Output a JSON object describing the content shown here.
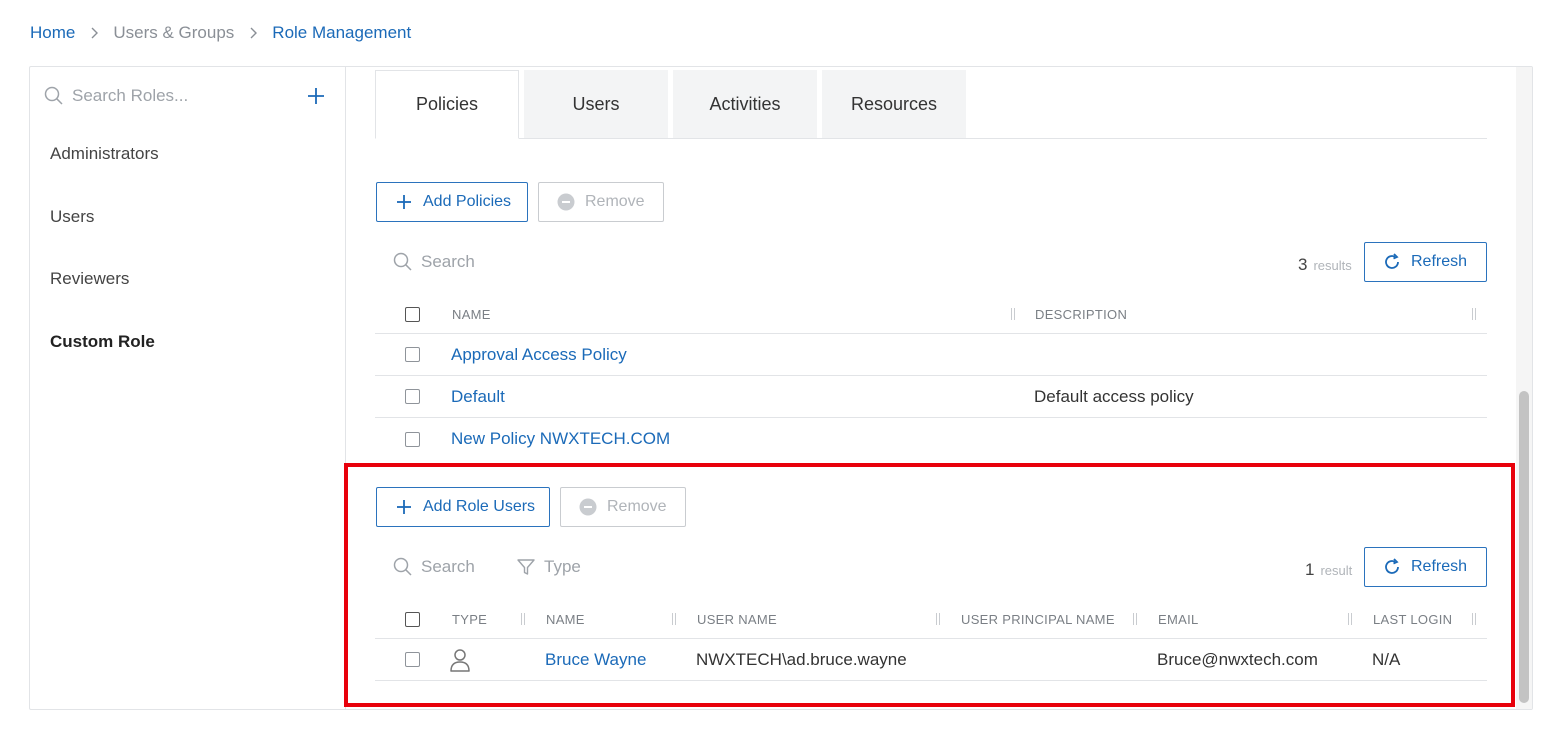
{
  "breadcrumb": {
    "home": "Home",
    "users_groups": "Users & Groups",
    "current": "Role Management"
  },
  "sidebar": {
    "search_placeholder": "Search Roles...",
    "add_icon": "plus-icon",
    "items": [
      {
        "label": "Administrators",
        "active": false
      },
      {
        "label": "Users",
        "active": false
      },
      {
        "label": "Reviewers",
        "active": false
      },
      {
        "label": "Custom Role",
        "active": true
      }
    ]
  },
  "tabs": [
    {
      "label": "Policies",
      "active": true
    },
    {
      "label": "Users",
      "active": false
    },
    {
      "label": "Activities",
      "active": false
    },
    {
      "label": "Resources",
      "active": false
    }
  ],
  "policies": {
    "add_label": "Add Policies",
    "remove_label": "Remove",
    "search_placeholder": "Search",
    "count": "3",
    "count_label": "results",
    "refresh_label": "Refresh",
    "columns": {
      "name": "NAME",
      "description": "DESCRIPTION"
    },
    "rows": [
      {
        "name": "Approval Access Policy",
        "description": ""
      },
      {
        "name": "Default",
        "description": "Default access policy"
      },
      {
        "name": "New Policy NWXTECH.COM",
        "description": ""
      }
    ]
  },
  "role_users": {
    "add_label": "Add Role Users",
    "remove_label": "Remove",
    "search_placeholder": "Search",
    "type_filter_label": "Type",
    "count": "1",
    "count_label": "result",
    "refresh_label": "Refresh",
    "columns": {
      "type": "TYPE",
      "name": "NAME",
      "user_name": "USER NAME",
      "upn": "USER PRINCIPAL NAME",
      "email": "EMAIL",
      "last_login": "LAST LOGIN"
    },
    "rows": [
      {
        "type_icon": "user-icon",
        "name": "Bruce Wayne",
        "user_name": "NWXTECH\\ad.bruce.wayne",
        "upn": "",
        "email": "Bruce@nwxtech.com",
        "last_login": "N/A"
      }
    ]
  },
  "colors": {
    "link": "#1b6ab8",
    "highlight": "#e8000b",
    "border": "#e2e4e7"
  }
}
